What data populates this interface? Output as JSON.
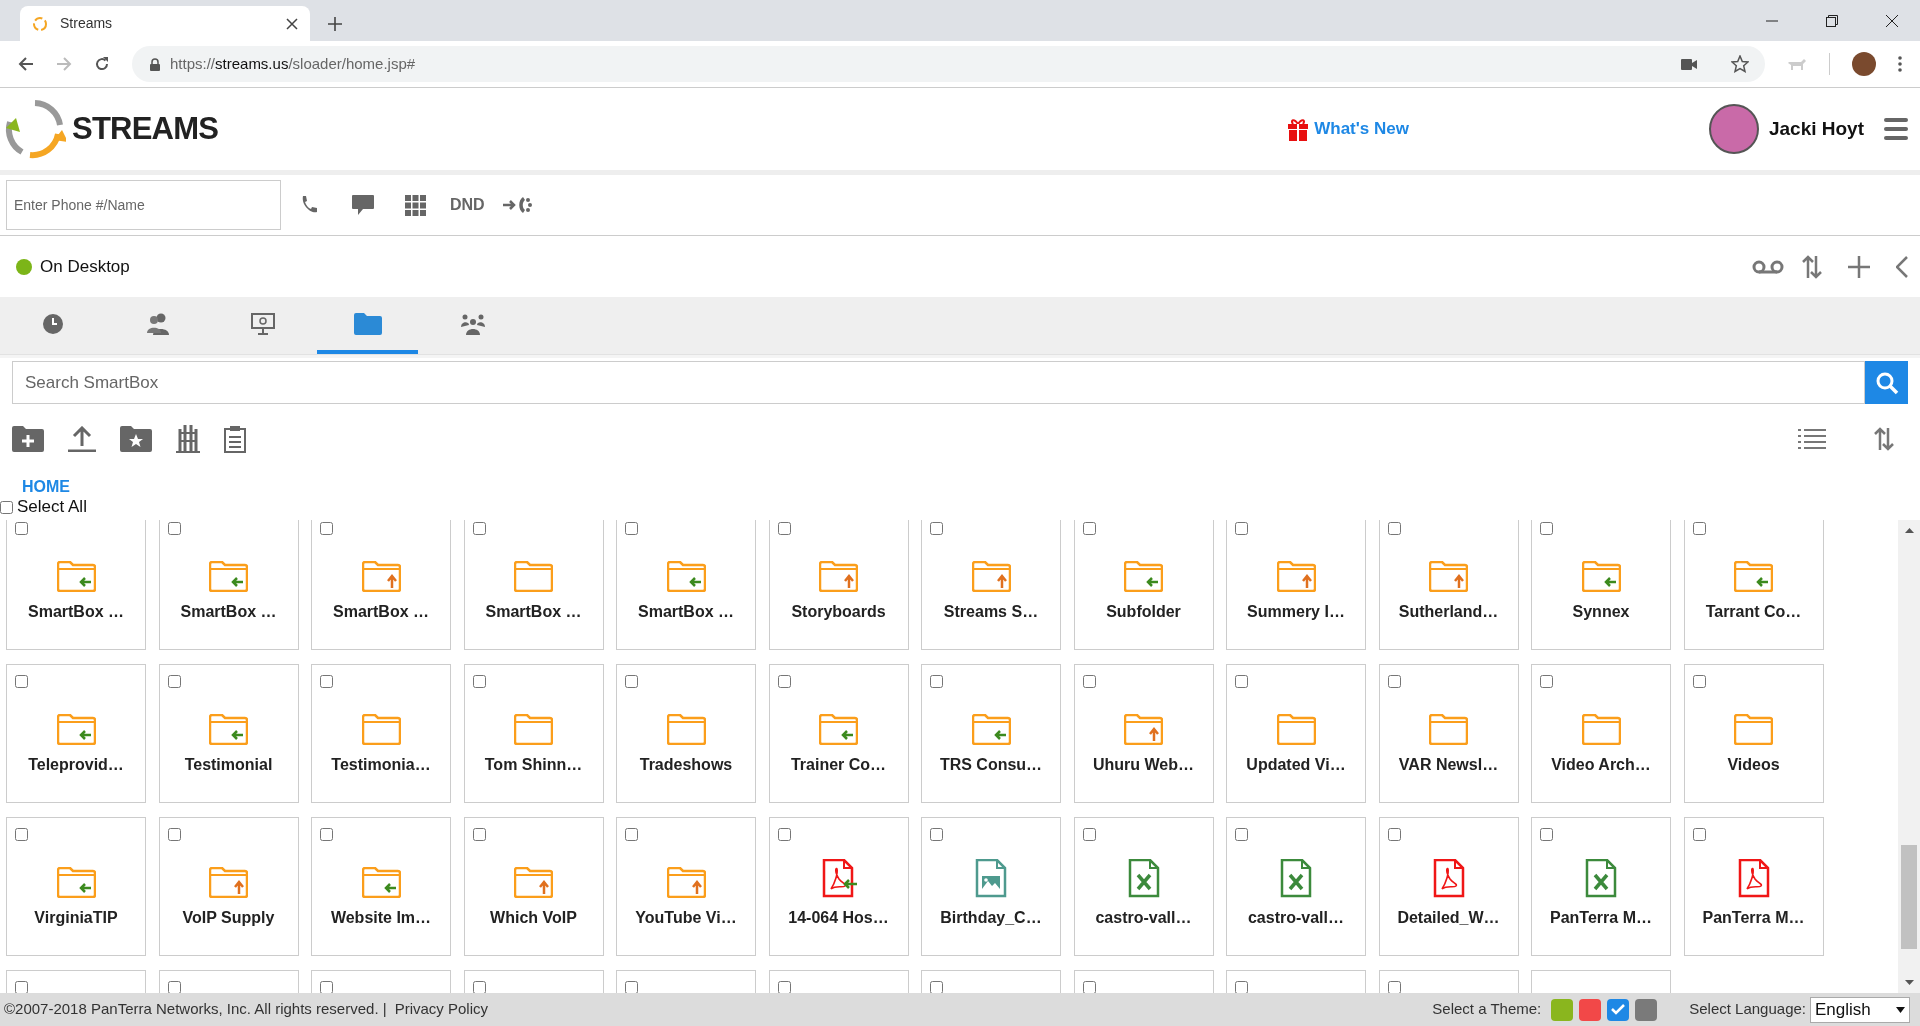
{
  "browser": {
    "tab_title": "Streams",
    "url_scheme": "https://",
    "url_host": "streams.us",
    "url_path": "/sloader/home.jsp#"
  },
  "header": {
    "logo_text": "STREAMS",
    "whats_new": "What's New",
    "user_name": "Jacki Hoyt"
  },
  "dialer": {
    "placeholder": "Enter Phone #/Name",
    "dnd": "DND"
  },
  "presence": {
    "status": "On Desktop",
    "color": "#7cb518"
  },
  "tabs": [
    {
      "kind": "clock",
      "selected": false
    },
    {
      "kind": "people",
      "selected": false
    },
    {
      "kind": "monitor",
      "selected": false
    },
    {
      "kind": "folder",
      "selected": true
    },
    {
      "kind": "group",
      "selected": false
    }
  ],
  "search": {
    "placeholder": "Search SmartBox"
  },
  "breadcrumb": "HOME",
  "select_all": {
    "label": "Select All",
    "checked": false
  },
  "rows": [
    [
      {
        "kind": "folder-shared",
        "name": "SmartBox …",
        "checked": false
      },
      {
        "kind": "folder-shared",
        "name": "SmartBox …",
        "checked": false
      },
      {
        "kind": "folder-upload",
        "name": "SmartBox …",
        "checked": false
      },
      {
        "kind": "folder",
        "name": "SmartBox …",
        "checked": false
      },
      {
        "kind": "folder-shared",
        "name": "SmartBox …",
        "checked": false
      },
      {
        "kind": "folder-upload",
        "name": "Storyboards",
        "checked": false
      },
      {
        "kind": "folder-upload",
        "name": "Streams S…",
        "checked": false
      },
      {
        "kind": "folder-shared",
        "name": "Subfolder",
        "checked": false
      },
      {
        "kind": "folder-upload",
        "name": "Summery I…",
        "checked": false
      },
      {
        "kind": "folder-upload",
        "name": "Sutherland…",
        "checked": false
      },
      {
        "kind": "folder-shared",
        "name": "Synnex",
        "checked": false
      },
      {
        "kind": "folder-shared",
        "name": "Tarrant Co…",
        "checked": false
      }
    ],
    [
      {
        "kind": "folder-shared",
        "name": "Teleprovid…",
        "checked": false
      },
      {
        "kind": "folder-shared",
        "name": "Testimonial",
        "checked": false
      },
      {
        "kind": "folder",
        "name": "Testimonia…",
        "checked": false
      },
      {
        "kind": "folder",
        "name": "Tom Shinn…",
        "checked": false
      },
      {
        "kind": "folder",
        "name": "Tradeshows",
        "checked": false
      },
      {
        "kind": "folder-shared",
        "name": "Trainer Co…",
        "checked": false
      },
      {
        "kind": "folder-shared",
        "name": "TRS Consu…",
        "checked": false
      },
      {
        "kind": "folder-upload",
        "name": "Uhuru Web…",
        "checked": false
      },
      {
        "kind": "folder",
        "name": "Updated Vi…",
        "checked": false
      },
      {
        "kind": "folder",
        "name": "VAR Newsl…",
        "checked": false
      },
      {
        "kind": "folder",
        "name": "Video Arch…",
        "checked": false
      },
      {
        "kind": "folder",
        "name": "Videos",
        "checked": false
      }
    ],
    [
      {
        "kind": "folder-shared",
        "name": "VirginiaTIP",
        "checked": false
      },
      {
        "kind": "folder-upload",
        "name": "VoIP Supply",
        "checked": false
      },
      {
        "kind": "folder-shared",
        "name": "Website Im…",
        "checked": false
      },
      {
        "kind": "folder-upload",
        "name": "Which VoIP",
        "checked": false
      },
      {
        "kind": "folder-upload",
        "name": "YouTube Vi…",
        "checked": false
      },
      {
        "kind": "pdf-shared",
        "name": "14-064 Hos…",
        "checked": false
      },
      {
        "kind": "image",
        "name": "Birthday_C…",
        "checked": false
      },
      {
        "kind": "excel",
        "name": "castro-vall…",
        "checked": false
      },
      {
        "kind": "excel",
        "name": "castro-vall…",
        "checked": false
      },
      {
        "kind": "pdf",
        "name": "Detailed_W…",
        "checked": false
      },
      {
        "kind": "excel",
        "name": "PanTerra M…",
        "checked": false
      },
      {
        "kind": "pdf",
        "name": "PanTerra M…",
        "checked": false
      }
    ],
    [
      {
        "kind": "partial",
        "checked": false
      },
      {
        "kind": "partial",
        "checked": false
      },
      {
        "kind": "partial",
        "checked": false
      },
      {
        "kind": "partial",
        "checked": false
      },
      {
        "kind": "partial",
        "checked": false
      },
      {
        "kind": "partial",
        "checked": false
      },
      {
        "kind": "partial",
        "checked": false
      },
      {
        "kind": "partial",
        "checked": false
      },
      {
        "kind": "partial",
        "checked": false
      },
      {
        "kind": "partial",
        "checked": false
      },
      {
        "kind": "partial-blank"
      }
    ]
  ],
  "footer": {
    "copyright": "©2007-2018 PanTerra Networks, Inc. All rights reserved. |",
    "privacy": "Privacy Policy",
    "theme_label": "Select a Theme:",
    "themes": [
      {
        "color": "#8ab61e",
        "selected": false
      },
      {
        "color": "#f24848",
        "selected": false
      },
      {
        "color": "#1e88e5",
        "selected": true
      },
      {
        "color": "#7a7a7a",
        "selected": false
      }
    ],
    "language_label": "Select Language:",
    "language": "English"
  }
}
